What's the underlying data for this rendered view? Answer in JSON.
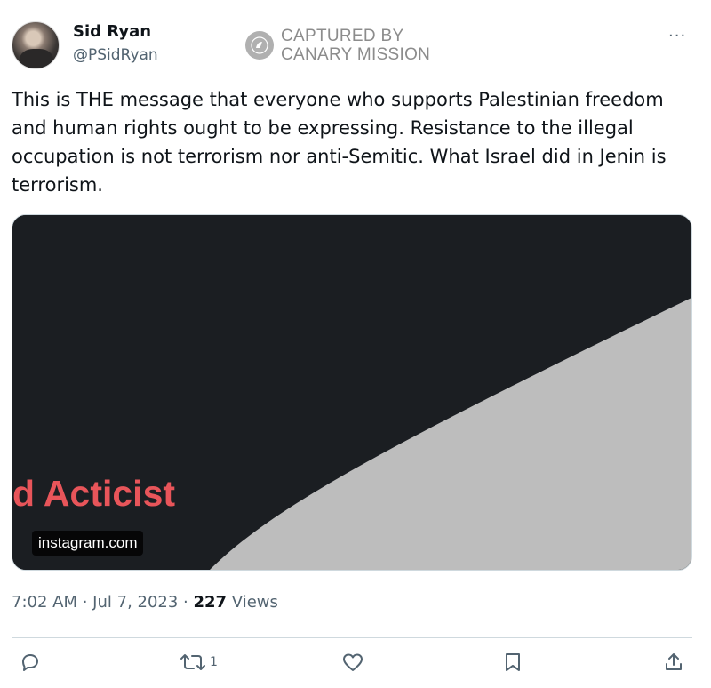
{
  "author": {
    "name": "Sid Ryan",
    "handle": "@PSidRyan"
  },
  "watermark": {
    "line1": "CAPTURED BY",
    "line2": "CANARY MISSION"
  },
  "more_icon": "...",
  "tweet": {
    "text": "This is THE message that everyone who supports Palestinian freedom and human rights ought to be expressing. Resistance to the illegal occupation is not terrorism nor anti-Semitic. What Israel did in Jenin is terrorism."
  },
  "media": {
    "caption": "d Acticist",
    "link": "instagram.com",
    "colors": {
      "dark": "#1b1e22",
      "light": "#bdbdbd",
      "caption": "#e8555a"
    }
  },
  "meta": {
    "time": "7:02 AM",
    "sep1": " · ",
    "date": "Jul 7, 2023",
    "sep2": " · ",
    "views_count": "227",
    "views_label": " Views"
  },
  "actions": {
    "reply": {
      "icon": "reply-icon"
    },
    "retweet": {
      "icon": "retweet-icon",
      "count": "1"
    },
    "like": {
      "icon": "heart-icon"
    },
    "bookmark": {
      "icon": "bookmark-icon"
    },
    "share": {
      "icon": "share-icon"
    }
  }
}
